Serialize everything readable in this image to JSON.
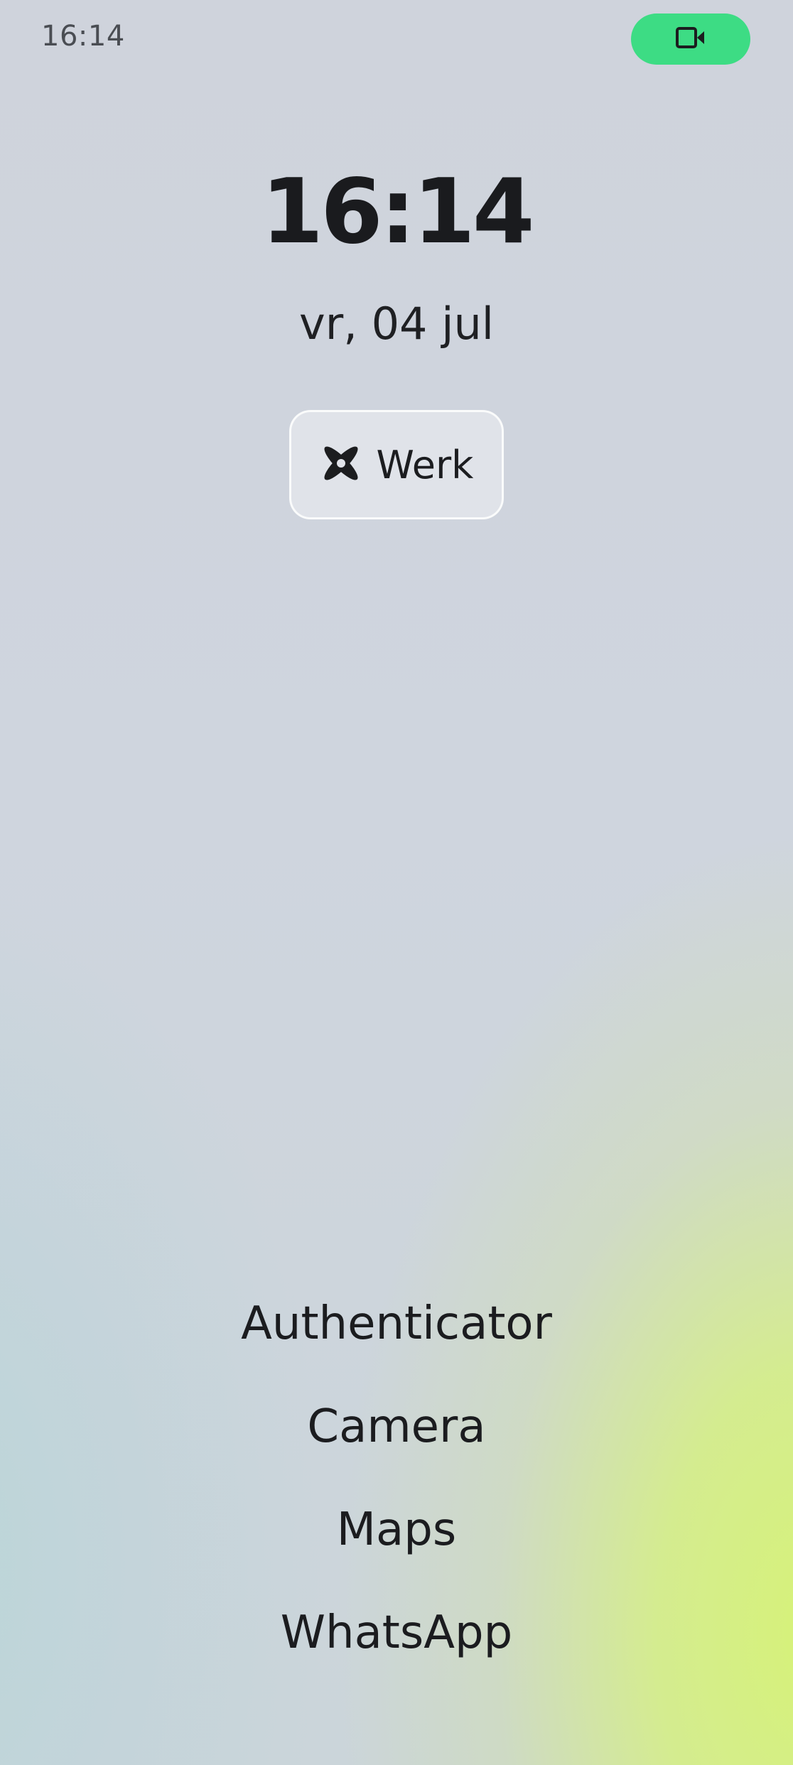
{
  "status_bar": {
    "time": "16:14",
    "video_icon": "video-camera-icon",
    "accent": "#3ddc84"
  },
  "lockscreen": {
    "clock": "16:14",
    "date": "vr, 04 jul"
  },
  "profile": {
    "label": "Werk",
    "icon": "x-blossom-icon"
  },
  "apps": [
    "Authenticator",
    "Camera",
    "Maps",
    "WhatsApp"
  ]
}
